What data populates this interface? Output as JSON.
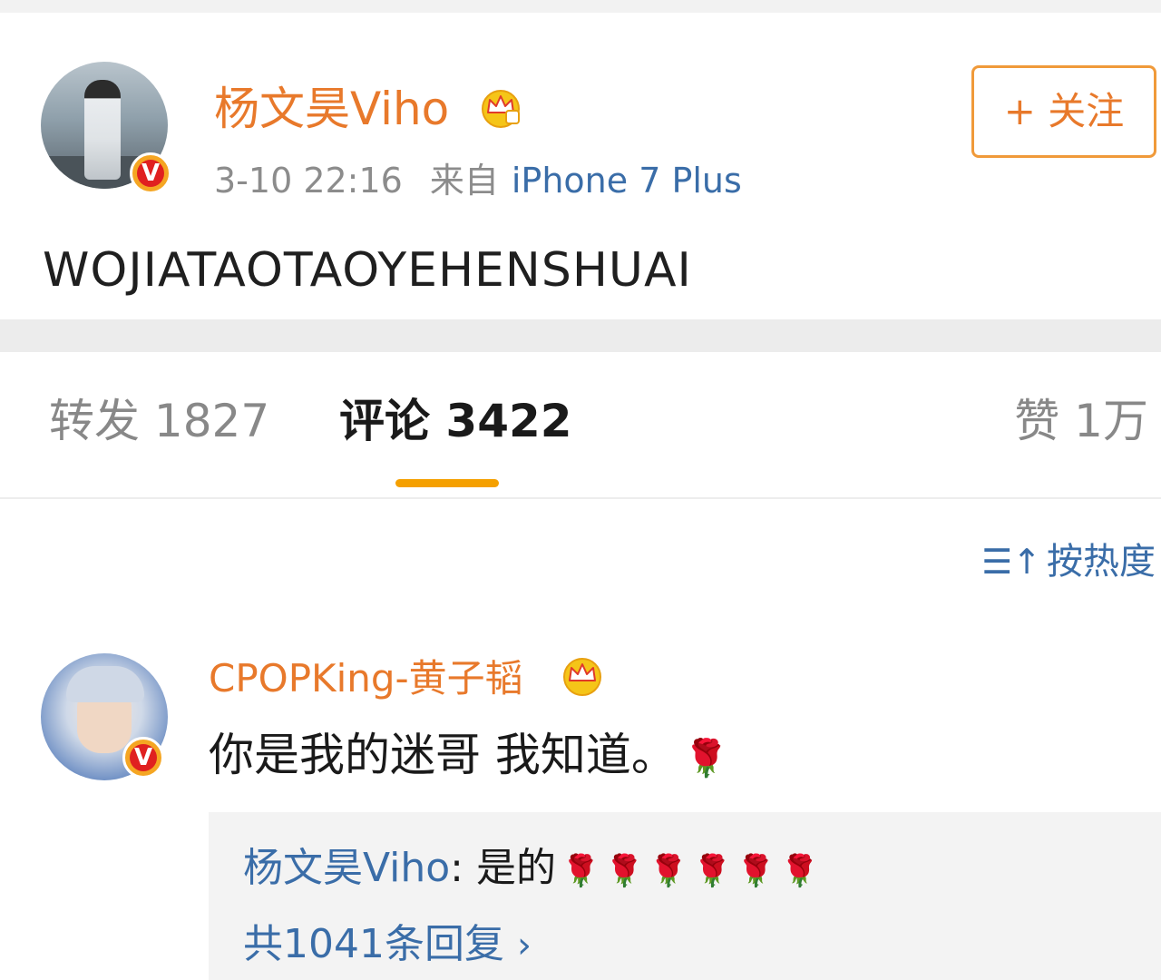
{
  "post": {
    "username": "杨文昊Viho",
    "verified_label": "V",
    "time": "3-10 22:16",
    "source_prefix": "来自",
    "device": "iPhone 7 Plus",
    "follow_label": "+ 关注",
    "text": "WOJIATAOTAOYEHENSHUAI"
  },
  "tabs": {
    "repost": "转发 1827",
    "comment": "评论 3422",
    "like": "赞 1万"
  },
  "comments": {
    "sort_icon": "☰↑",
    "sort_label": "按热度",
    "items": [
      {
        "username": "CPOPKing-黄子韬",
        "verified_label": "V",
        "text": "你是我的迷哥 我知道。",
        "reply": {
          "user": "杨文昊Viho",
          "separator": ": ",
          "text": "是的",
          "count_label": "共1041条回复",
          "chevron": "›"
        }
      }
    ]
  },
  "icons": {
    "rose": "🌹",
    "crown": "crown-badge-icon"
  },
  "colors": {
    "username": "#e8792b",
    "link": "#3a6da8",
    "accent": "#f5a000",
    "verified": "#e02020"
  }
}
